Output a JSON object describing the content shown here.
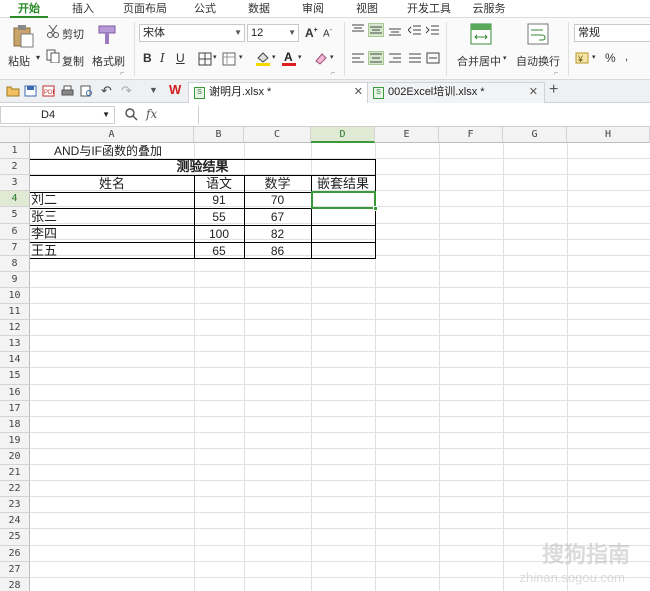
{
  "ribbon_tabs": [
    "开始",
    "插入",
    "页面布局",
    "公式",
    "数据",
    "审阅",
    "视图",
    "开发工具",
    "云服务"
  ],
  "active_tab": "开始",
  "ribbon": {
    "paste": "粘贴",
    "cut": "剪切",
    "copy": "复制",
    "format_painter": "格式刷",
    "font_name": "宋体",
    "font_size": "12",
    "bold": "B",
    "italic": "I",
    "underline": "U",
    "merge_center": "合并居中",
    "wrap_text": "自动换行",
    "number_format": "常规",
    "percent": "%"
  },
  "doc_tabs": [
    {
      "label": "谢明月.xlsx *",
      "active": true
    },
    {
      "label": "002Excel培训.xlsx *",
      "active": false
    }
  ],
  "formula_bar": {
    "name_box": "D4",
    "fx": "fx",
    "formula": ""
  },
  "columns": [
    "A",
    "B",
    "C",
    "D",
    "E",
    "F",
    "G",
    "H"
  ],
  "selected_column": "D",
  "rows": [
    "1",
    "2",
    "3",
    "4",
    "5",
    "6",
    "7",
    "8",
    "9",
    "10",
    "11",
    "12",
    "13",
    "14",
    "15",
    "16",
    "17",
    "18",
    "19",
    "20",
    "21",
    "22",
    "23",
    "24",
    "25",
    "26",
    "27",
    "28"
  ],
  "selected_row": "4",
  "sheet": {
    "a1": "AND与IF函数的叠加",
    "title": "测验结果",
    "headers": [
      "姓名",
      "语文",
      "数学",
      "嵌套结果"
    ],
    "data": [
      [
        "刘二",
        "91",
        "70"
      ],
      [
        "张三",
        "55",
        "67"
      ],
      [
        "李四",
        "100",
        "82"
      ],
      [
        "王五",
        "65",
        "86"
      ]
    ]
  },
  "watermark": {
    "text": "搜狗指南",
    "url": "zhinan.sogou.com"
  }
}
